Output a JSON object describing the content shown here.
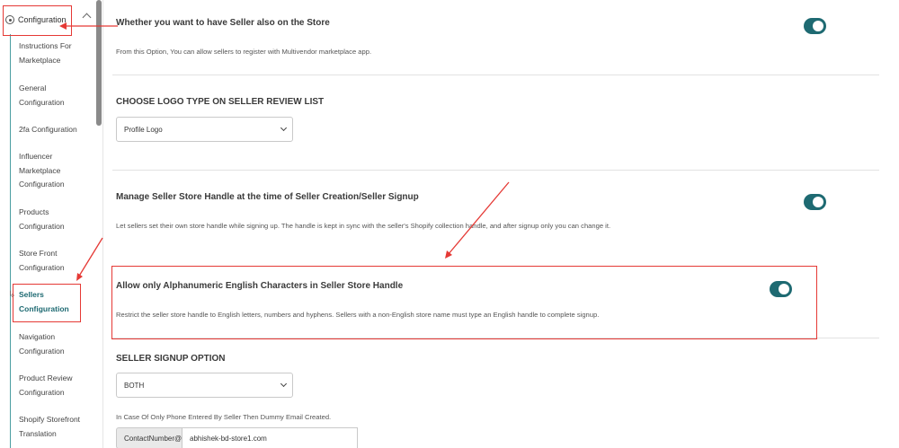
{
  "sidebar": {
    "header": "Configuration",
    "items": [
      {
        "label": "Instructions For Marketplace"
      },
      {
        "label": "General Configuration"
      },
      {
        "label": "2fa Configuration"
      },
      {
        "label": "Influencer Marketplace Configuration"
      },
      {
        "label": "Products Configuration"
      },
      {
        "label": "Store Front Configuration"
      },
      {
        "label": "Sellers Configuration"
      },
      {
        "label": "Navigation Configuration"
      },
      {
        "label": "Product Review Configuration"
      },
      {
        "label": "Shopify Storefront Translation"
      }
    ],
    "active_index": 6
  },
  "sections": {
    "seller_on_store": {
      "title": "Whether you want to have Seller also on the Store",
      "desc": "From this Option, You can allow sellers to register with Multivendor marketplace app.",
      "enabled": true
    },
    "logo_type": {
      "title": "CHOOSE LOGO TYPE ON SELLER REVIEW LIST",
      "selected": "Profile Logo"
    },
    "store_handle": {
      "title": "Manage Seller Store Handle at the time of Seller Creation/Seller Signup",
      "desc": "Let sellers set their own store handle while signing up. The handle is kept in sync with the seller's Shopify collection handle, and after signup only you can change it.",
      "enabled": true
    },
    "alphanumeric": {
      "title": "Allow only Alphanumeric English Characters in Seller Store Handle",
      "desc": "Restrict the seller store handle to English letters, numbers and hyphens. Sellers with a non-English store name must type an English handle to complete signup.",
      "enabled": true
    },
    "signup_option": {
      "title": "SELLER SIGNUP OPTION",
      "selected": "BOTH",
      "note": "In Case Of Only Phone Entered By Seller Then Dummy Email Created.",
      "prefix": "ContactNumber@",
      "value": "abhishek-bd-store1.com"
    }
  },
  "colors": {
    "accent": "#1e6a72",
    "annotation": "#e53935"
  }
}
